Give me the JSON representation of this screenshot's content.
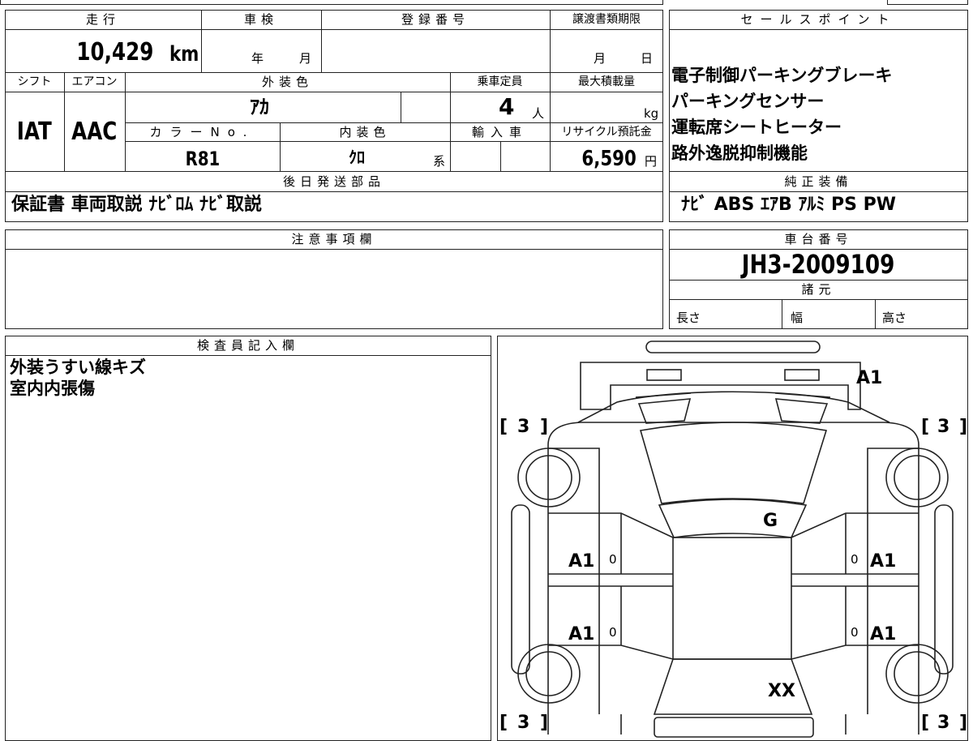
{
  "headers": {
    "mileage": "走行",
    "inspection": "車検",
    "registration_no": "登録番号",
    "doc_deadline": "譲渡書類期限",
    "shift": "シフト",
    "aircon": "エアコン",
    "exterior_color": "外装色",
    "capacity": "乗車定員",
    "max_load": "最大積載量",
    "color_no": "カラーNo.",
    "interior_color": "内装色",
    "import": "輸入車",
    "recycle_fee": "リサイクル預託金",
    "later_parts": "後日発送部品",
    "sales_points": "セールスポイント",
    "genuine_equipment": "純正装備",
    "notes": "注意事項欄",
    "chassis_no": "車台番号",
    "specs": "諸元",
    "inspector": "検査員記入欄"
  },
  "values": {
    "mileage": "10,429",
    "mileage_unit": "km",
    "inspection_year_unit": "年",
    "inspection_month_unit": "月",
    "deadline_month_unit": "月",
    "deadline_day_unit": "日",
    "shift": "IAT",
    "aircon": "AAC",
    "exterior_color": "ｱｶ",
    "capacity": "4",
    "capacity_unit": "人",
    "max_load_unit": "kg",
    "color_no": "R81",
    "interior_color": "ｸﾛ",
    "interior_suffix": "系",
    "recycle_fee": "6,590",
    "recycle_unit": "円",
    "later_parts": "保証書 車両取説 ﾅﾋﾞﾛﾑ ﾅﾋﾞ取説",
    "genuine_equipment": "ﾅﾋﾞ ABS ｴｱB ｱﾙﾐ PS PW",
    "chassis_no": "JH3-2009109",
    "spec_length": "長さ",
    "spec_width": "幅",
    "spec_height": "高さ"
  },
  "sales_points": [
    "電子制御パーキングブレーキ",
    "パーキングセンサー",
    "運転席シートヒーター",
    "路外逸脱抑制機能"
  ],
  "inspector_notes": [
    "外装うすい線キズ",
    "室内内張傷"
  ],
  "diagram": {
    "tire_left_top": "3",
    "tire_right_top": "3",
    "tire_left_bottom": "3",
    "tire_right_bottom": "3",
    "front_bumper": "A1",
    "windshield": "G",
    "left_front_door": "A1",
    "left_rear_door": "A1",
    "right_front_door": "A1",
    "right_rear_door": "A1",
    "rear": "XX",
    "door_zero": "0",
    "bracket_open": "[",
    "bracket_close": "]"
  }
}
